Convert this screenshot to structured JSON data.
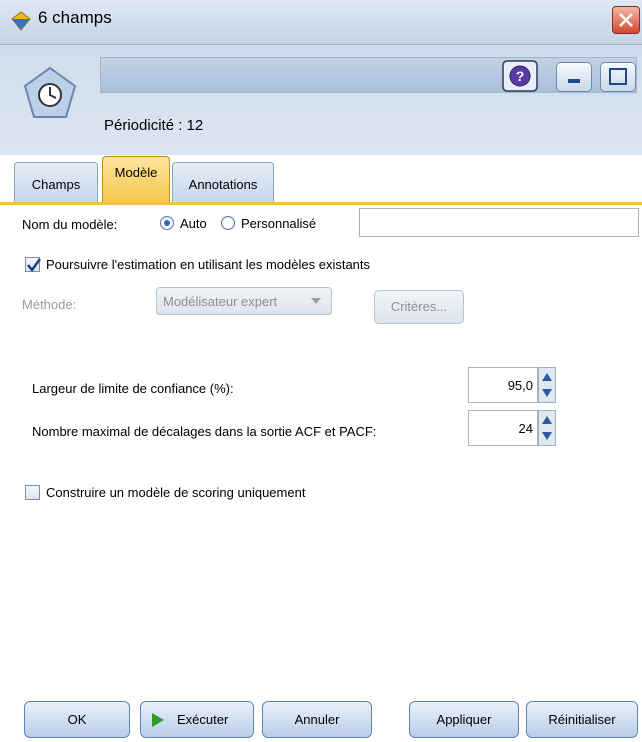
{
  "window": {
    "title": "6 champs"
  },
  "header": {
    "node_name_value": "",
    "periodicity": "Périodicité : 12"
  },
  "tabs": [
    {
      "label": "Champs",
      "active": false
    },
    {
      "label": "Modèle",
      "active": true
    },
    {
      "label": "Annotations",
      "active": false
    }
  ],
  "model_name": {
    "label": "Nom du modèle:",
    "options": [
      {
        "label": "Auto",
        "selected": true
      },
      {
        "label": "Personnalisé",
        "selected": false
      }
    ],
    "custom_value": ""
  },
  "continue_estimation": {
    "label": "Poursuivre l'estimation en utilisant les modèles existants",
    "checked": true
  },
  "method": {
    "label": "Méthode:",
    "value": "Modélisateur expert",
    "criteria_label": "Critères..."
  },
  "confidence": {
    "label": "Largeur de limite de confiance (%):",
    "value": "95,0"
  },
  "lags": {
    "label": "Nombre maximal de décalages dans la sortie ACF et PACF:",
    "value": "24"
  },
  "scoring_only": {
    "label": "Construire un modèle de scoring uniquement",
    "checked": false
  },
  "buttons": {
    "ok": "OK",
    "run": "Exécuter",
    "cancel": "Annuler",
    "apply": "Appliquer",
    "reset": "Réinitialiser"
  },
  "colors": {
    "accent_tab": "#f7c54a",
    "title_bar": "#c4d3e6",
    "run_arrow": "#2e9d2e"
  },
  "icons": [
    "diamond-app-icon",
    "close-icon",
    "timeseries-node-icon",
    "help-icon",
    "minimize-icon",
    "maximize-icon",
    "dropdown-arrow-icon",
    "spinner-arrows-icon",
    "play-icon"
  ]
}
